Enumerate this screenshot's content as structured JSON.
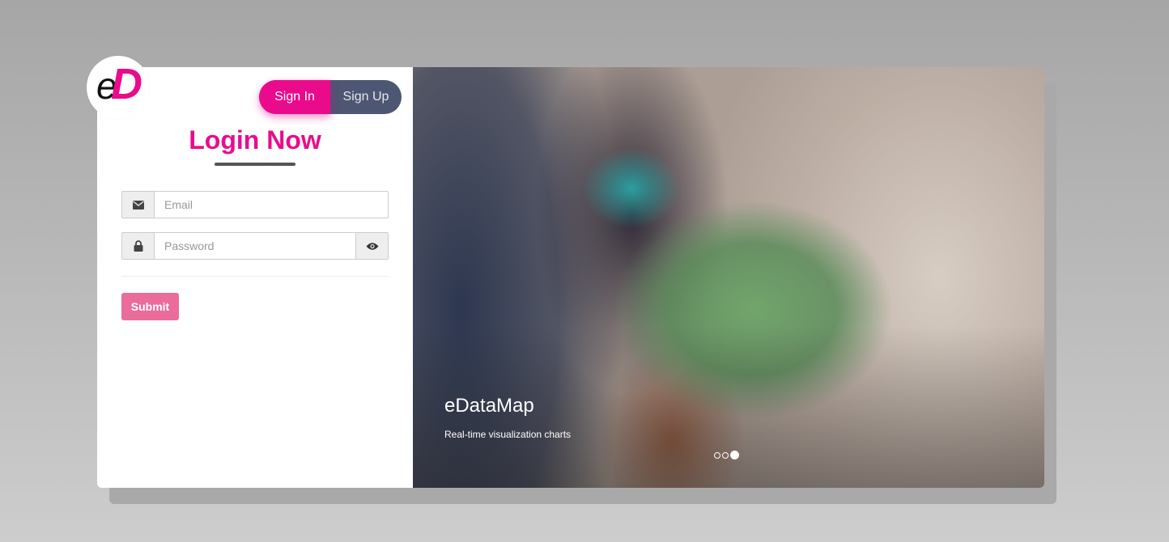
{
  "brand": {
    "logo_e": "e",
    "logo_d": "D"
  },
  "auth_toggle": {
    "sign_in_label": "Sign In",
    "sign_up_label": "Sign Up",
    "active": "Sign In"
  },
  "form": {
    "title": "Login Now",
    "email": {
      "placeholder": "Email",
      "value": ""
    },
    "password": {
      "placeholder": "Password",
      "value": ""
    },
    "submit_label": "Submit"
  },
  "carousel": {
    "title": "eDataMap",
    "subtitle": "Real-time visualization charts",
    "slide_count": 3,
    "active_slide": 3
  },
  "colors": {
    "accent": "#ea0a8c",
    "toggle_bg": "#4d5672",
    "submit_bg": "#ea6c9a"
  },
  "icons": {
    "email": "envelope-icon",
    "password": "lock-icon",
    "reveal": "eye-icon"
  }
}
